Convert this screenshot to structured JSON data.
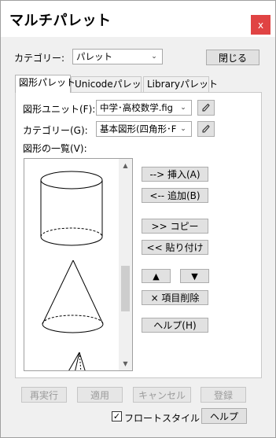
{
  "window": {
    "title": "マルチパレット",
    "close_glyph": "x"
  },
  "category": {
    "label": "カテゴリー:",
    "value": "パレット"
  },
  "close_button": "閉じる",
  "tabs": [
    {
      "label": "図形パレット",
      "active": true
    },
    {
      "label": "Unicodeパレット",
      "active": false
    },
    {
      "label": "Libraryパレット",
      "active": false
    }
  ],
  "shape_panel": {
    "unit_label": "図形ユニット(F):",
    "unit_value": "中学･高校数学.fig",
    "category_label": "カテゴリー(G):",
    "category_value": "基本図形(四角形･F",
    "list_label": "図形の一覧(V):",
    "list_items": [
      "cylinder-shape",
      "cone-shape",
      "pyramid-shape"
    ]
  },
  "actions": {
    "insert": "-->  挿入(A)",
    "add": "<--  追加(B)",
    "copy": ">>  コピー",
    "paste": "<<  貼り付け",
    "move_up": "▲",
    "move_down": "▼",
    "delete": "×  項目削除",
    "help": "ヘルプ(H)"
  },
  "footer": {
    "redo": "再実行",
    "apply": "適用",
    "cancel": "キャンセル",
    "register": "登録",
    "float_style_label": "フロートスタイル",
    "float_style_checked": true,
    "help": "ヘルプ"
  },
  "colors": {
    "close_bg": "#e04343",
    "window_bg": "#f0f0f0",
    "panel_bg": "#ffffff"
  }
}
